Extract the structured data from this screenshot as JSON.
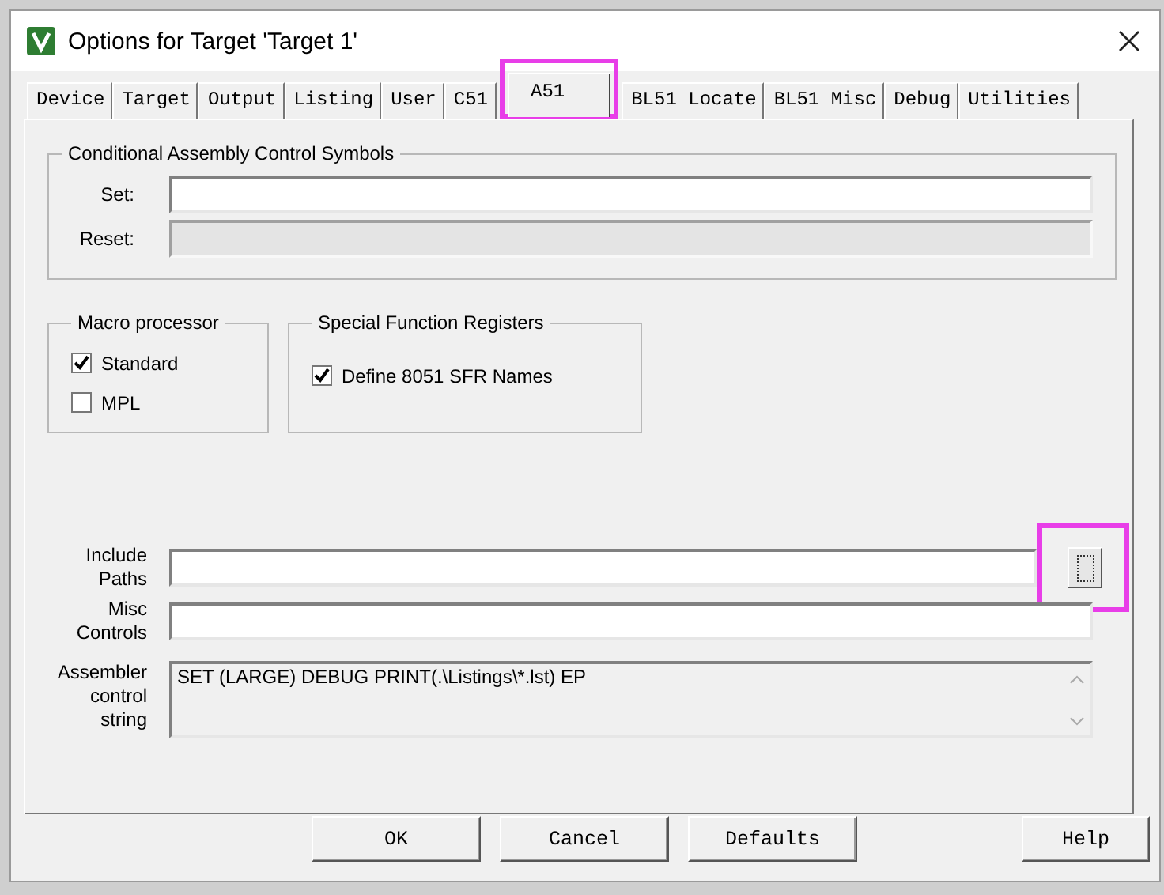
{
  "window": {
    "title": "Options for Target 'Target 1'"
  },
  "tabs": [
    {
      "label": "Device",
      "selected": false,
      "highlighted": false
    },
    {
      "label": "Target",
      "selected": false,
      "highlighted": false
    },
    {
      "label": "Output",
      "selected": false,
      "highlighted": false
    },
    {
      "label": "Listing",
      "selected": false,
      "highlighted": false
    },
    {
      "label": "User",
      "selected": false,
      "highlighted": false
    },
    {
      "label": "C51",
      "selected": false,
      "highlighted": false
    },
    {
      "label": "A51",
      "selected": true,
      "highlighted": true
    },
    {
      "label": "BL51 Locate",
      "selected": false,
      "highlighted": false
    },
    {
      "label": "BL51 Misc",
      "selected": false,
      "highlighted": false
    },
    {
      "label": "Debug",
      "selected": false,
      "highlighted": false
    },
    {
      "label": "Utilities",
      "selected": false,
      "highlighted": false
    }
  ],
  "conditional_group": {
    "title": "Conditional Assembly Control Symbols",
    "fields": [
      {
        "label": "Set:",
        "disabled": false
      },
      {
        "label": "Reset:",
        "disabled": true
      }
    ]
  },
  "macro_processor": {
    "title": "Macro processor",
    "options": [
      {
        "label": "Standard",
        "checked": true
      },
      {
        "label": "MPL",
        "checked": false
      }
    ]
  },
  "sfr": {
    "title": "Special Function Registers",
    "options": [
      {
        "label": "Define 8051 SFR Names",
        "checked": true
      }
    ]
  },
  "include_paths": {
    "label": "Include\nPaths",
    "browse_highlighted": true
  },
  "misc_controls": {
    "label": "Misc\nControls"
  },
  "assembler_control": {
    "label": "Assembler\ncontrol\nstring",
    "value": "SET (LARGE) DEBUG PRINT(.\\Listings\\*.lst) EP"
  },
  "buttons": [
    {
      "label": "OK",
      "kind": "left"
    },
    {
      "label": "Cancel",
      "kind": "left"
    },
    {
      "label": "Defaults",
      "kind": "left"
    },
    {
      "label": "Help",
      "kind": "right"
    }
  ]
}
